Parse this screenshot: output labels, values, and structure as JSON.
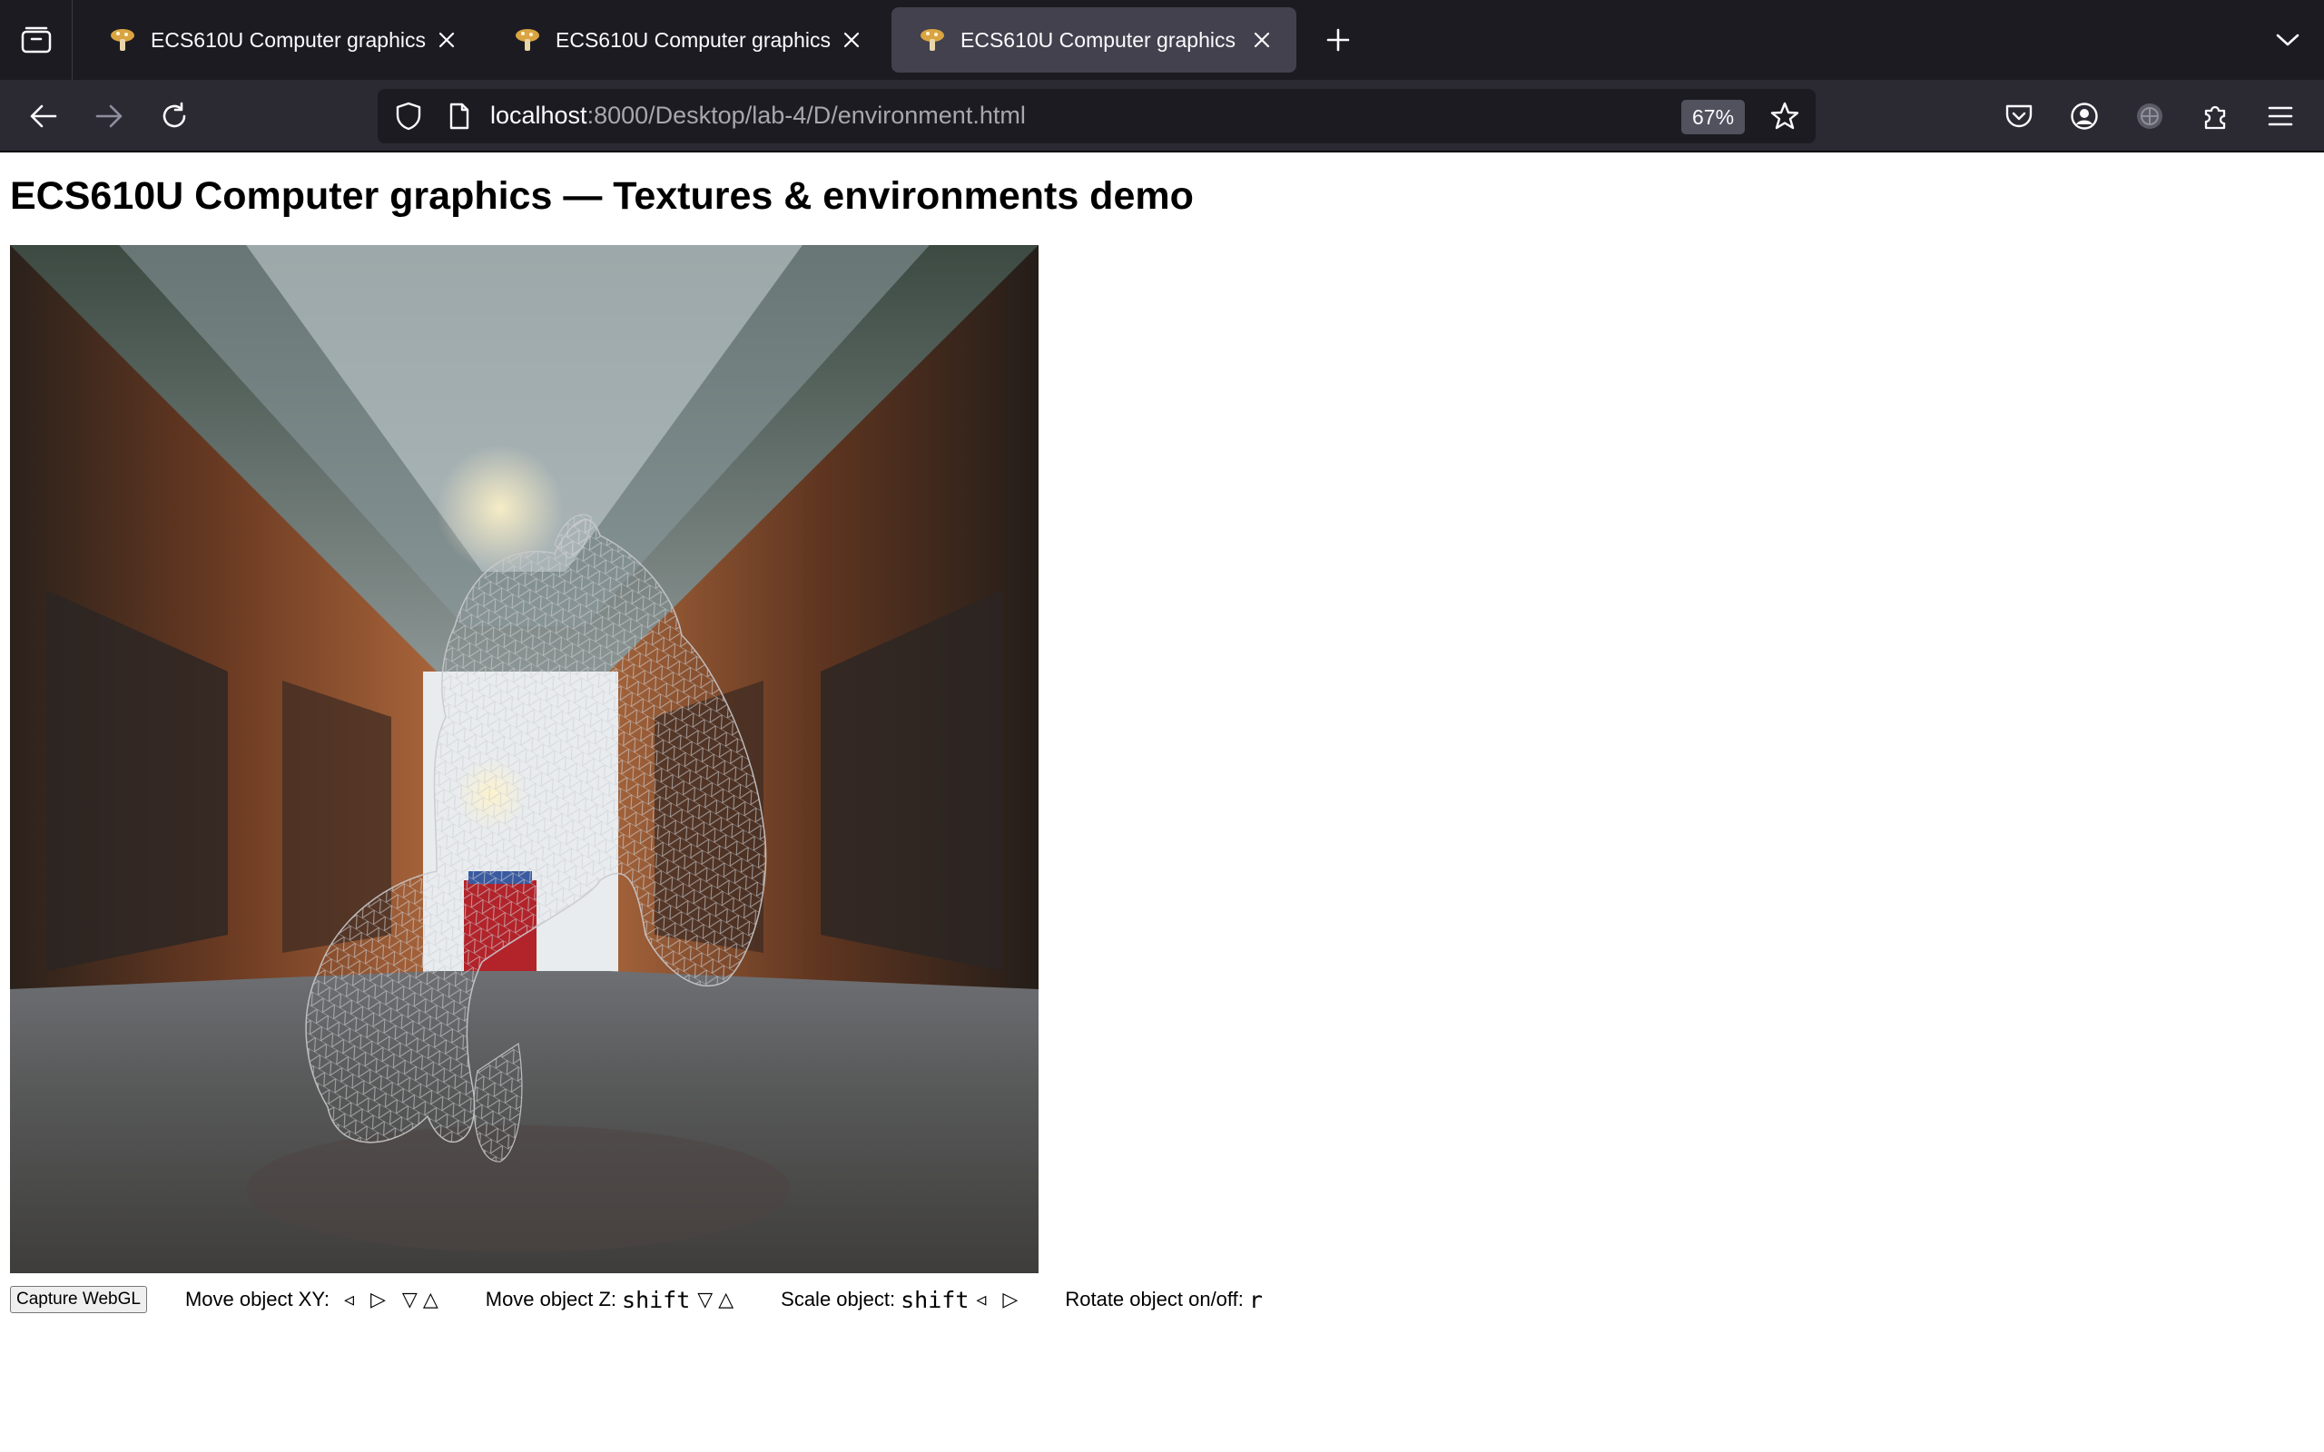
{
  "browser": {
    "tabs": [
      {
        "title": "ECS610U Computer graphics",
        "active": false
      },
      {
        "title": "ECS610U Computer graphics",
        "active": false
      },
      {
        "title": "ECS610U Computer graphics",
        "active": true
      }
    ],
    "url_host": "localhost",
    "url_path": ":8000/Desktop/lab-4/D/environment.html",
    "zoom": "67%"
  },
  "page": {
    "title": "ECS610U Computer graphics — Textures & environments demo",
    "capture_button": "Capture WebGL",
    "controls": {
      "move_xy_label": "Move object XY:",
      "move_xy_keys": [
        "◃",
        "▷",
        "▽",
        "△"
      ],
      "move_z_label": "Move object Z:",
      "move_z_modifier": "shift",
      "move_z_keys": [
        "▽",
        "△"
      ],
      "scale_label": "Scale object:",
      "scale_modifier": "shift",
      "scale_keys": [
        "◃",
        "▷"
      ],
      "rotate_label": "Rotate object on/off:",
      "rotate_key": "r"
    }
  },
  "colors": {
    "tabbar_bg": "#1c1b22",
    "active_tab_bg": "#42414d",
    "navbar_bg": "#2b2a33",
    "urlbar_bg": "#1c1b22",
    "text_light": "#fbfbfe"
  }
}
